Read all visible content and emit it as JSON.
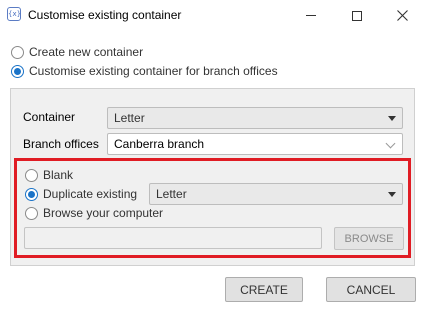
{
  "window": {
    "title": "Customise existing container",
    "app_icon_text": "{x}"
  },
  "mode_options": [
    {
      "label": "Create new container",
      "selected": false
    },
    {
      "label": "Customise existing container for branch offices",
      "selected": true
    }
  ],
  "fields": {
    "container_label": "Container",
    "container_value": "Letter",
    "branch_label": "Branch offices",
    "branch_value": "Canberra branch"
  },
  "source_options": [
    {
      "label": "Blank",
      "selected": false
    },
    {
      "label": "Duplicate existing",
      "selected": true
    },
    {
      "label": "Browse your computer",
      "selected": false
    }
  ],
  "duplicate_value": "Letter",
  "browse_path_value": "",
  "buttons": {
    "browse": "BROWSE",
    "create": "CREATE",
    "cancel": "CANCEL"
  },
  "colors": {
    "accent": "#1a73c8",
    "highlight": "#e01c24"
  }
}
